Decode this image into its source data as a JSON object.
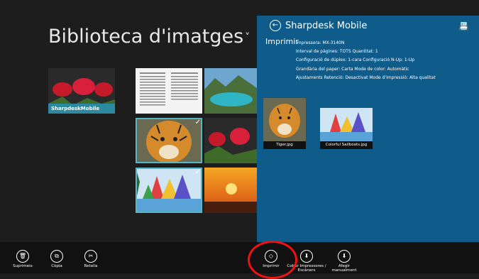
{
  "library": {
    "title": "Biblioteca d'imatges",
    "chevron": "˅",
    "folder_label": "SharpdeskMobile",
    "check": "✓"
  },
  "panel": {
    "app_title": "Sharpdesk Mobile",
    "back_icon": "←",
    "app_icon": "📇",
    "print_title": "Imprimir",
    "details": [
      "Impressora: MX-3140N",
      "Interval de pàgines: TOTS   Quantitat: 1",
      "Configuració de dúplex: 1-cara   Configuració N-Up: 1-Up",
      "Grandària del paper: Carta   Mode de color: Automàtic",
      "Ajustaments Retenció: Desactivat   Mode d'impressió: Alta qualitat"
    ],
    "doc1": "Tiger.jpg",
    "doc2": "Colorful Sailboats.jpg"
  },
  "appbar": {
    "left": [
      {
        "label": "Suprimeix",
        "icon": "🗑"
      },
      {
        "label": "Còpia",
        "icon": "⧉"
      },
      {
        "label": "Retalla",
        "icon": "✂"
      }
    ],
    "right": [
      {
        "label": "Imprimir",
        "icon": "◇"
      },
      {
        "label": "Cobar Impressores /",
        "label2": "Escàners",
        "icon": "⬇"
      },
      {
        "label": "Afegir",
        "label2": "manualment",
        "icon": "⬇"
      }
    ]
  }
}
